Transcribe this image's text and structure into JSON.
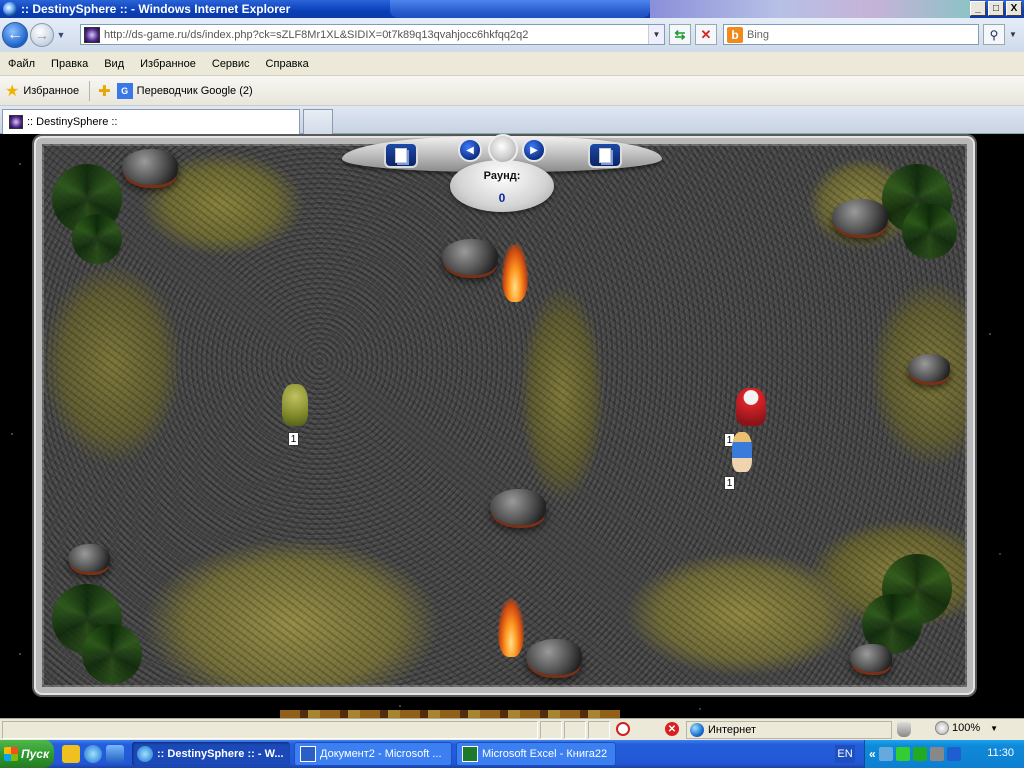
{
  "window": {
    "title": ":: DestinySphere :: - Windows Internet Explorer",
    "buttons": [
      "_",
      "□",
      "X"
    ]
  },
  "addressbar": {
    "url": "http://ds-game.ru/ds/index.php?ck=sZLF8Mr1XL&SIDIX=0t7k89q13qvahjocc6hkfqq2q2",
    "search_placeholder": "Bing",
    "search_engine_glyph": "b"
  },
  "menu": {
    "items": [
      "Файл",
      "Правка",
      "Вид",
      "Избранное",
      "Сервис",
      "Справка"
    ]
  },
  "favorites": {
    "label": "Избранное",
    "translator": "Переводчик Google (2)",
    "translator_glyph": "G"
  },
  "tabs": {
    "active_label": ":: DestinySphere ::"
  },
  "game": {
    "round_label": "Раунд:",
    "round_value": "0",
    "units": [
      {
        "name": "troll",
        "count": "1"
      },
      {
        "name": "santa",
        "count": "1"
      },
      {
        "name": "girl",
        "count": "1"
      }
    ]
  },
  "statusbar": {
    "zone": "Интернет",
    "zoom": "100%"
  },
  "taskbar": {
    "start": "Пуск",
    "tasks": [
      {
        "label": ":: DestinySphere :: - W...",
        "active": true
      },
      {
        "label": "Документ2 - Microsoft ...",
        "active": false
      },
      {
        "label": "Microsoft Excel - Книга22",
        "active": false
      }
    ],
    "lang": "EN",
    "clock": "11:30"
  },
  "colors": {
    "titlebar": "#0a3fb8",
    "taskbar": "#245edb",
    "round_value": "#0a2a9a"
  }
}
